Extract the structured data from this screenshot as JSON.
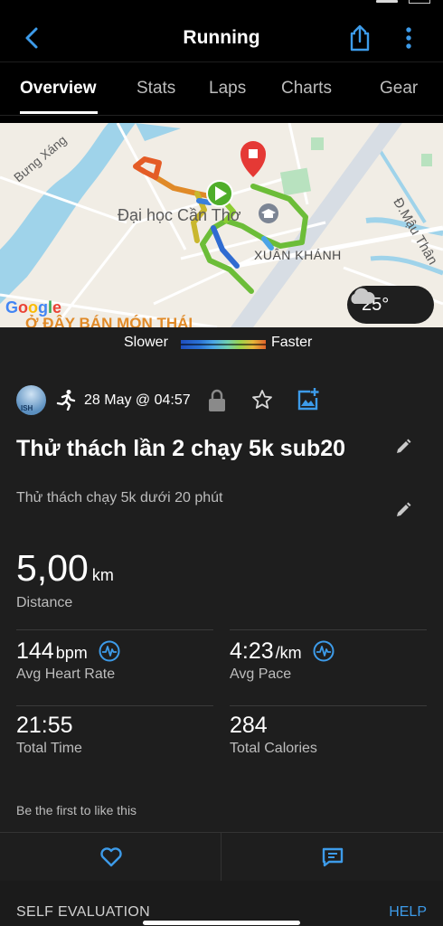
{
  "header": {
    "title": "Running",
    "back_icon": "chevron-left-icon",
    "share_icon": "share-icon",
    "more_icon": "more-vertical-icon",
    "accent": "#3d9be9"
  },
  "tabs": [
    {
      "label": "Overview",
      "active": true
    },
    {
      "label": "Stats"
    },
    {
      "label": "Laps"
    },
    {
      "label": "Charts"
    },
    {
      "label": "Gear"
    }
  ],
  "map": {
    "labels": {
      "river": "Bưng Xáng",
      "university": "Đại học Cần Thơ",
      "district": "XUÂN KHÁNH",
      "street": "Đ.Mậu Thân",
      "poi": "Ở ĐÂY BÁN MÓN THÁI",
      "google": "Google"
    },
    "weather": {
      "temperature": "25°",
      "icon": "cloud-icon"
    }
  },
  "pace_legend": {
    "slower": "Slower",
    "faster": "Faster"
  },
  "activity": {
    "avatar_text": "ISH",
    "date": "28 May @ 04:57",
    "title": "Thử thách lần 2 chạy 5k sub20",
    "description": "Thử thách chạy 5k dưới 20 phút"
  },
  "stats": {
    "distance": {
      "value": "5,00",
      "unit": "km",
      "label": "Distance"
    },
    "heart_rate": {
      "value": "144",
      "unit": "bpm",
      "label": "Avg Heart Rate"
    },
    "pace": {
      "value": "4:23",
      "unit": "/km",
      "label": "Avg Pace"
    },
    "time": {
      "value": "21:55",
      "label": "Total Time"
    },
    "calories": {
      "value": "284",
      "label": "Total Calories"
    }
  },
  "social": {
    "like_prompt": "Be the first to like this"
  },
  "footer": {
    "self_evaluation": "SELF EVALUATION",
    "help": "HELP"
  }
}
